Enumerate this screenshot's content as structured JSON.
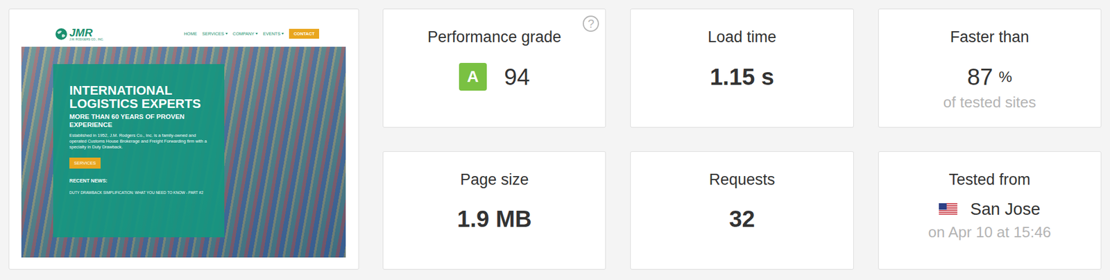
{
  "site_preview": {
    "logo": {
      "text": "JMR",
      "subtitle": "J.M. RODGERS CO., INC."
    },
    "nav": [
      {
        "label": "HOME",
        "dropdown": false
      },
      {
        "label": "SERVICES",
        "dropdown": true
      },
      {
        "label": "COMPANY",
        "dropdown": true
      },
      {
        "label": "EVENTS",
        "dropdown": true
      }
    ],
    "contact": "CONTACT",
    "hero": {
      "title": "INTERNATIONAL LOGISTICS EXPERTS",
      "subtitle": "MORE THAN 60 YEARS OF PROVEN EXPERIENCE",
      "text": "Established in 1952, J.M. Rodgers Co., Inc. is a family-owned and operated Customs House Brokerage and Freight Forwarding firm with a specialty in Duty Drawback.",
      "button": "SERVICES",
      "news_heading": "RECENT NEWS:",
      "news_item": "DUTY DRAWBACK SIMPLIFICATION: WHAT YOU NEED TO KNOW - PART #2"
    }
  },
  "metrics": [
    {
      "kind": "grade",
      "label": "Performance grade",
      "grade": "A",
      "value": "94",
      "help": "?"
    },
    {
      "kind": "value",
      "label": "Load time",
      "value": "1.15 s"
    },
    {
      "kind": "percent",
      "label": "Faster than",
      "value": "87",
      "unit": "%",
      "note": "of tested sites"
    },
    {
      "kind": "value",
      "label": "Page size",
      "value": "1.9 MB"
    },
    {
      "kind": "value",
      "label": "Requests",
      "value": "32"
    },
    {
      "kind": "location",
      "label": "Tested from",
      "value": "San Jose",
      "note": "on Apr 10 at 15:46"
    }
  ]
}
